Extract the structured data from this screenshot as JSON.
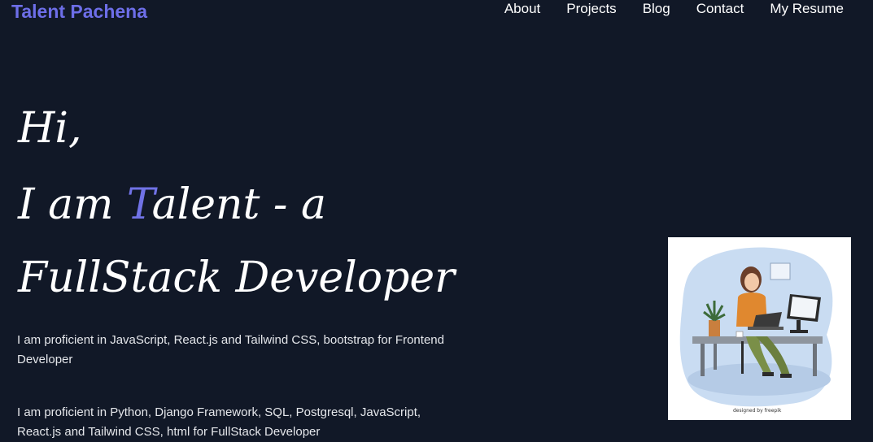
{
  "header": {
    "brand": "Talent Pachena",
    "nav": [
      {
        "label": "About"
      },
      {
        "label": "Projects"
      },
      {
        "label": "Blog"
      },
      {
        "label": "Contact"
      },
      {
        "label": "My Resume"
      }
    ]
  },
  "hero": {
    "line1": "Hi,",
    "line2_prefix": "I am ",
    "line2_accent": "T",
    "line2_suffix": "alent - a",
    "line3": "FullStack Developer"
  },
  "about": {
    "para1": "I am proficient in JavaScript, React.js and Tailwind CSS, bootstrap for Frontend Developer",
    "para2": "I am proficient in Python, Django Framework, SQL, Postgresql, JavaScript, React.js and Tailwind CSS, html for FullStack Developer"
  },
  "illustration": {
    "alt": "developer working at desk illustration",
    "credit": "designed by freepik"
  },
  "colors": {
    "background": "#111827",
    "brand": "#6d6ee8",
    "accent": "#7072e6"
  }
}
